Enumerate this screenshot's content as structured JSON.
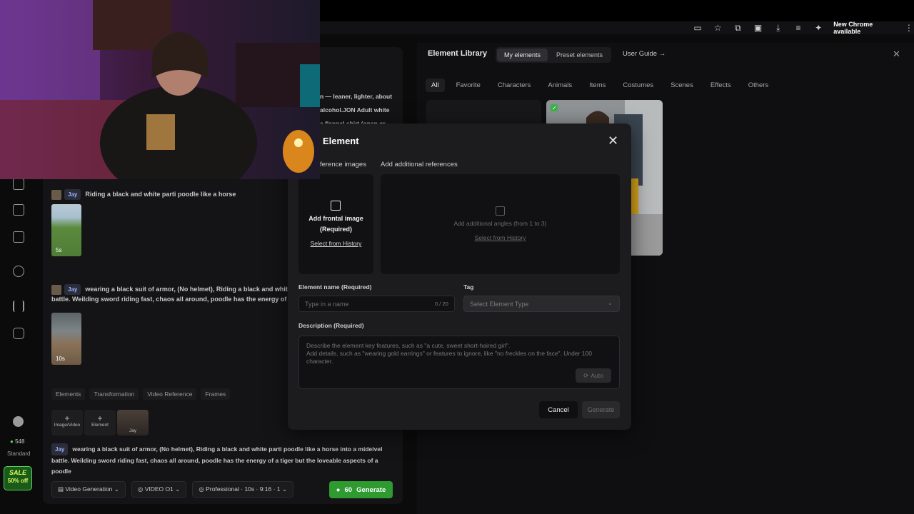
{
  "browser": {
    "chrome_available": "New Chrome available",
    "icons": [
      "tab-strip-icon",
      "star-icon",
      "extensions-icon",
      "media-icon",
      "download-icon",
      "playlist-icon",
      "puzzle-icon",
      "kebab-menu-icon"
    ]
  },
  "credits": {
    "amount": "548",
    "plan": "Standard"
  },
  "sale": {
    "title": "SALE",
    "discount": "50% off"
  },
  "history": [
    {
      "tag": "Jay",
      "prompt": "Riding a black and white parti poodle like a horse",
      "duration": "5s"
    },
    {
      "tag": "Jay",
      "prompt_line1": "wearing a black suit of armor, (No helmet), Riding a black and white pa",
      "prompt_line2": "battle. Weilding sword riding fast, chaos all around, poodle has the energy of a tiger b",
      "duration": "10s"
    }
  ],
  "bottom_tabs": [
    "Elements",
    "Transformation",
    "Video Reference",
    "Frames"
  ],
  "ref_buttons": {
    "image_video": "Image/Video",
    "element": "Element",
    "jay": "Jay"
  },
  "bottom_prompt": {
    "tag": "Jay",
    "line1": "wearing a black suit of armor, (No helmet), Riding a black and white parti poodle like a horse into a mideivel",
    "line2": "battle. Weilding sword riding fast, chaos all around, poodle has the energy of a tiger but the loveable aspects of a poodle"
  },
  "bottom_bar": {
    "mode": "Video Generation",
    "model": "VIDEO O1",
    "settings": "Professional · 10s · 9:16 · 1",
    "gen_cost": "60",
    "gen_label": "Generate"
  },
  "library": {
    "title": "Element Library",
    "tabs": [
      "My elements",
      "Preset elements"
    ],
    "user_guide": "User Guide",
    "categories": [
      "All",
      "Favorite",
      "Characters",
      "Animals",
      "Items",
      "Costumes",
      "Scenes",
      "Effects",
      "Others"
    ]
  },
  "partial_text": {
    "line1": "n — leaner, lighter, about",
    "line2": "alcohol.JON Adult white",
    "line3": "a flannel shirt (open or"
  },
  "modal": {
    "title": "Element",
    "refs_label": "ference images",
    "add_refs_label": "Add additional references",
    "frontal_label": "Add frontal image (Required)",
    "frontal_history": "Select from History",
    "angles_label": "Add additional angles (from 1 to 3)",
    "angles_history": "Select from History",
    "name_label": "Element name (Required)",
    "name_placeholder": "Type in a name",
    "name_count": "0 / 20",
    "tag_label": "Tag",
    "tag_placeholder": "Select Element Type",
    "desc_label": "Description (Required)",
    "desc_placeholder": "Describe the element key features, such as \"a cute, sweet short-haired girl\".\nAdd details, such as \"wearing gold earrings\" or features to ignore, like \"no freckles on the face\". Under 100 character.",
    "auto_label": "Auto",
    "cancel": "Cancel",
    "generate": "Generate"
  }
}
